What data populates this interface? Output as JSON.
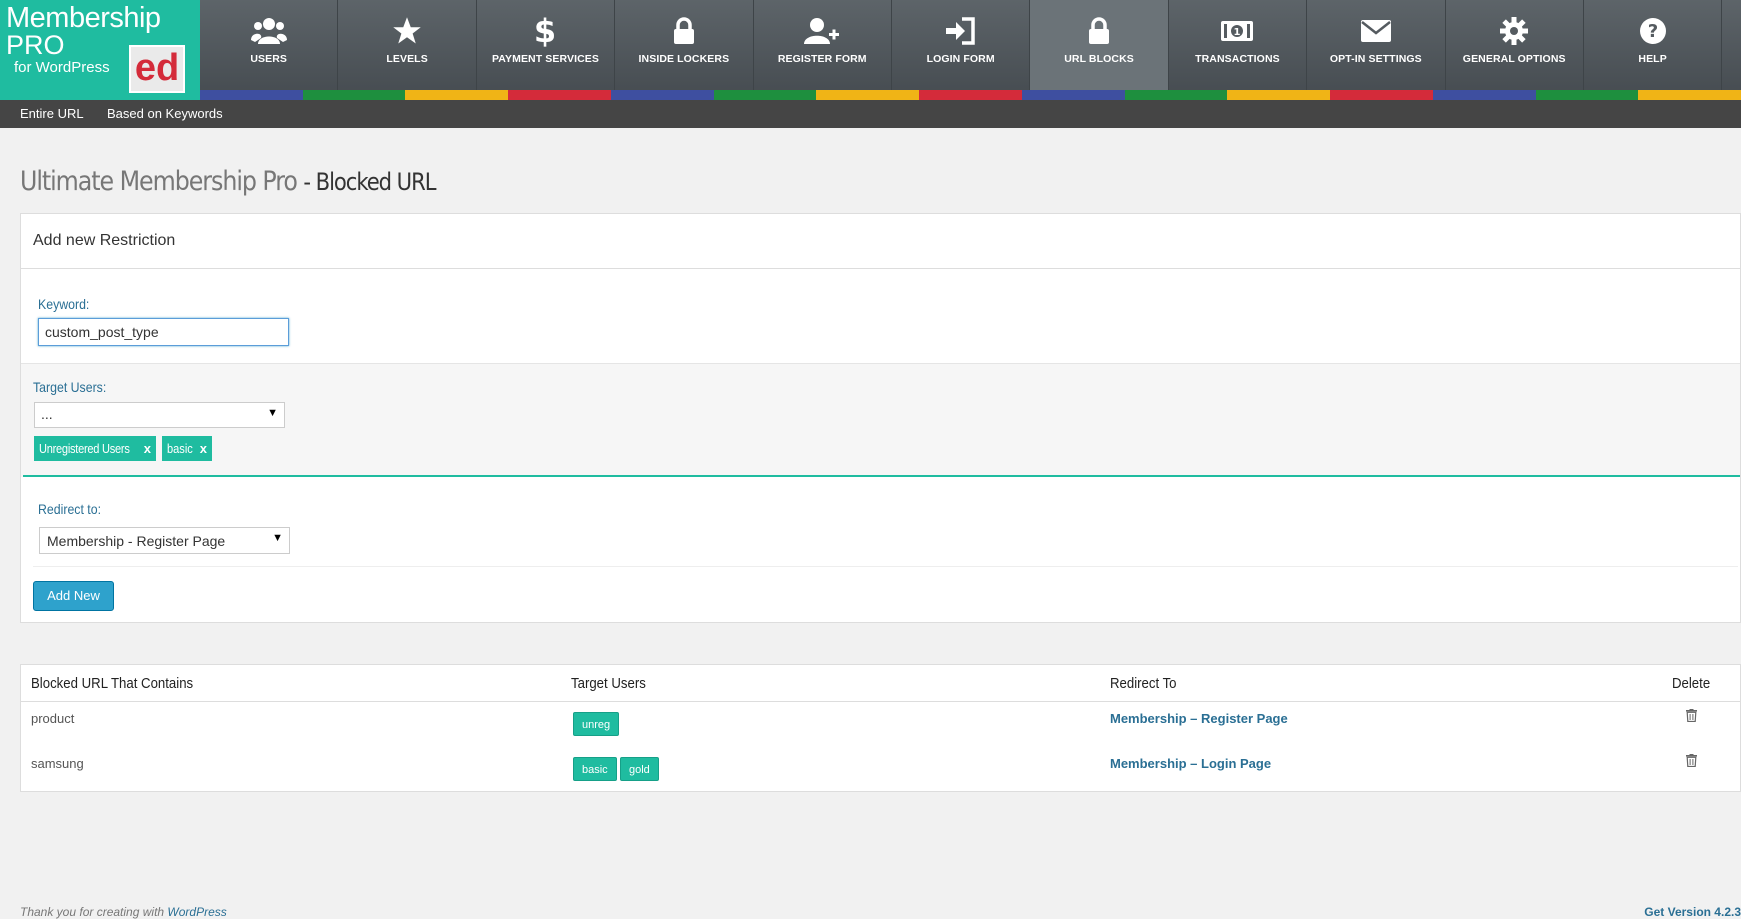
{
  "brand": {
    "line1": "Membership",
    "line2": "PRO",
    "line3": "for WordPress",
    "badge": "ed",
    "color": "#1fbca0"
  },
  "nav": [
    {
      "label": "USERS",
      "icon": "users-icon"
    },
    {
      "label": "LEVELS",
      "icon": "star-icon"
    },
    {
      "label": "PAYMENT SERVICES",
      "icon": "dollar-icon"
    },
    {
      "label": "INSIDE LOCKERS",
      "icon": "lock-icon"
    },
    {
      "label": "REGISTER FORM",
      "icon": "user-plus-icon"
    },
    {
      "label": "LOGIN FORM",
      "icon": "sign-in-icon"
    },
    {
      "label": "URL BLOCKS",
      "icon": "lock-icon",
      "active": true
    },
    {
      "label": "TRANSACTIONS",
      "icon": "money-icon"
    },
    {
      "label": "OPT-IN SETTINGS",
      "icon": "envelope-icon"
    },
    {
      "label": "GENERAL OPTIONS",
      "icon": "gear-icon"
    },
    {
      "label": "HELP",
      "icon": "question-icon"
    }
  ],
  "stripe_colors": [
    "#3e4fa0",
    "#1e8f3e",
    "#f0b416",
    "#d42b3a",
    "#3e4fa0",
    "#1e8f3e",
    "#f0b416",
    "#d42b3a",
    "#3e4fa0",
    "#1e8f3e",
    "#f0b416",
    "#d42b3a",
    "#3e4fa0",
    "#1e8f3e",
    "#f0b416"
  ],
  "subnav": {
    "entire": "Entire URL",
    "keywords": "Based on Keywords"
  },
  "page": {
    "title": "Ultimate Membership Pro",
    "subtitle": "- Blocked URL"
  },
  "form": {
    "heading": "Add new Restriction",
    "keyword_label": "Keyword:",
    "keyword_value": "custom_post_type",
    "target_label": "Target Users:",
    "target_select": "...",
    "target_tags": [
      "Unregistered Users",
      "basic"
    ],
    "tag_remove": "x",
    "redirect_label": "Redirect to:",
    "redirect_value": "Membership - Register Page",
    "submit": "Add New"
  },
  "table": {
    "headers": {
      "url": "Blocked URL That Contains",
      "users": "Target Users",
      "redirect": "Redirect To",
      "delete": "Delete"
    },
    "rows": [
      {
        "url": "product",
        "users": [
          "unreg"
        ],
        "redirect": "Membership – Register Page"
      },
      {
        "url": "samsung",
        "users": [
          "basic",
          "gold"
        ],
        "redirect": "Membership – Login Page"
      }
    ]
  },
  "footer": {
    "text": "Thank you for creating with",
    "link": "WordPress",
    "version": "Get Version 4.2.3"
  }
}
